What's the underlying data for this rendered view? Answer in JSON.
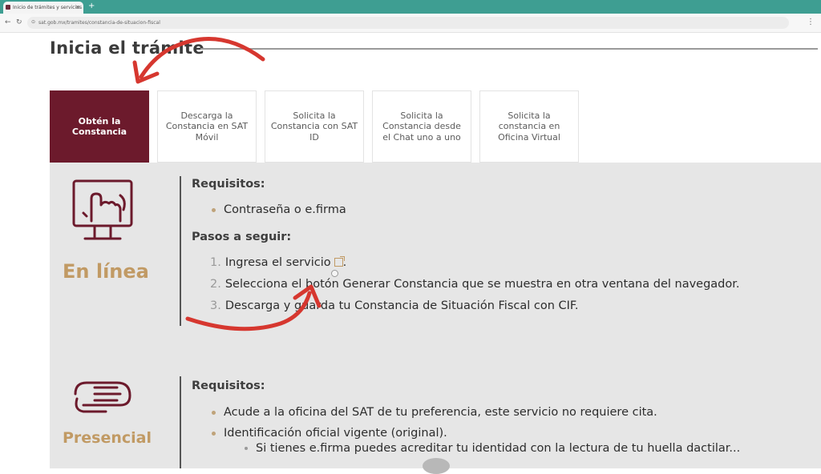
{
  "browser": {
    "tab_title": "Inicio de trámites y servicios",
    "url": "sat.gob.mx/tramites/constancia-de-situacion-fiscal"
  },
  "page": {
    "heading": "Inicia el trámite"
  },
  "tabs": [
    {
      "label": "Obtén la Constancia",
      "active": true
    },
    {
      "label": "Descarga la Constancia en SAT Móvil",
      "active": false
    },
    {
      "label": "Solicita la Constancia con SAT ID",
      "active": false
    },
    {
      "label": "Solicita la Constancia desde el Chat uno a uno",
      "active": false
    },
    {
      "label": "Solicita la constancia en Oficina Virtual",
      "active": false
    }
  ],
  "online": {
    "title": "En línea",
    "requirements_label": "Requisitos:",
    "requirements": [
      "Contraseña o e.firma"
    ],
    "steps_label": "Pasos a seguir:",
    "steps": [
      {
        "num": "1.",
        "text": "Ingresa el servicio",
        "suffix": "."
      },
      {
        "num": "2.",
        "text": "Selecciona el botón Generar Constancia que se muestra en otra ventana del navegador."
      },
      {
        "num": "3.",
        "text": "Descarga y guarda tu Constancia de Situación Fiscal con CIF."
      }
    ]
  },
  "inperson": {
    "title": "Presencial",
    "requirements_label": "Requisitos:",
    "requirements": [
      "Acude a la oficina del SAT de tu preferencia, este servicio no requiere cita.",
      "Identificación oficial vigente (original)."
    ],
    "sub_requirements": [
      "Si tienes e.firma puedes acreditar tu identidad con la lectura de tu huella dactilar..."
    ]
  },
  "colors": {
    "brand": "#6c1a2c",
    "accent_gold": "#c19a64",
    "annotation_arrow": "#d6372f"
  },
  "icons": [
    "computer-hand-icon",
    "handshake-icon",
    "external-link-icon"
  ]
}
